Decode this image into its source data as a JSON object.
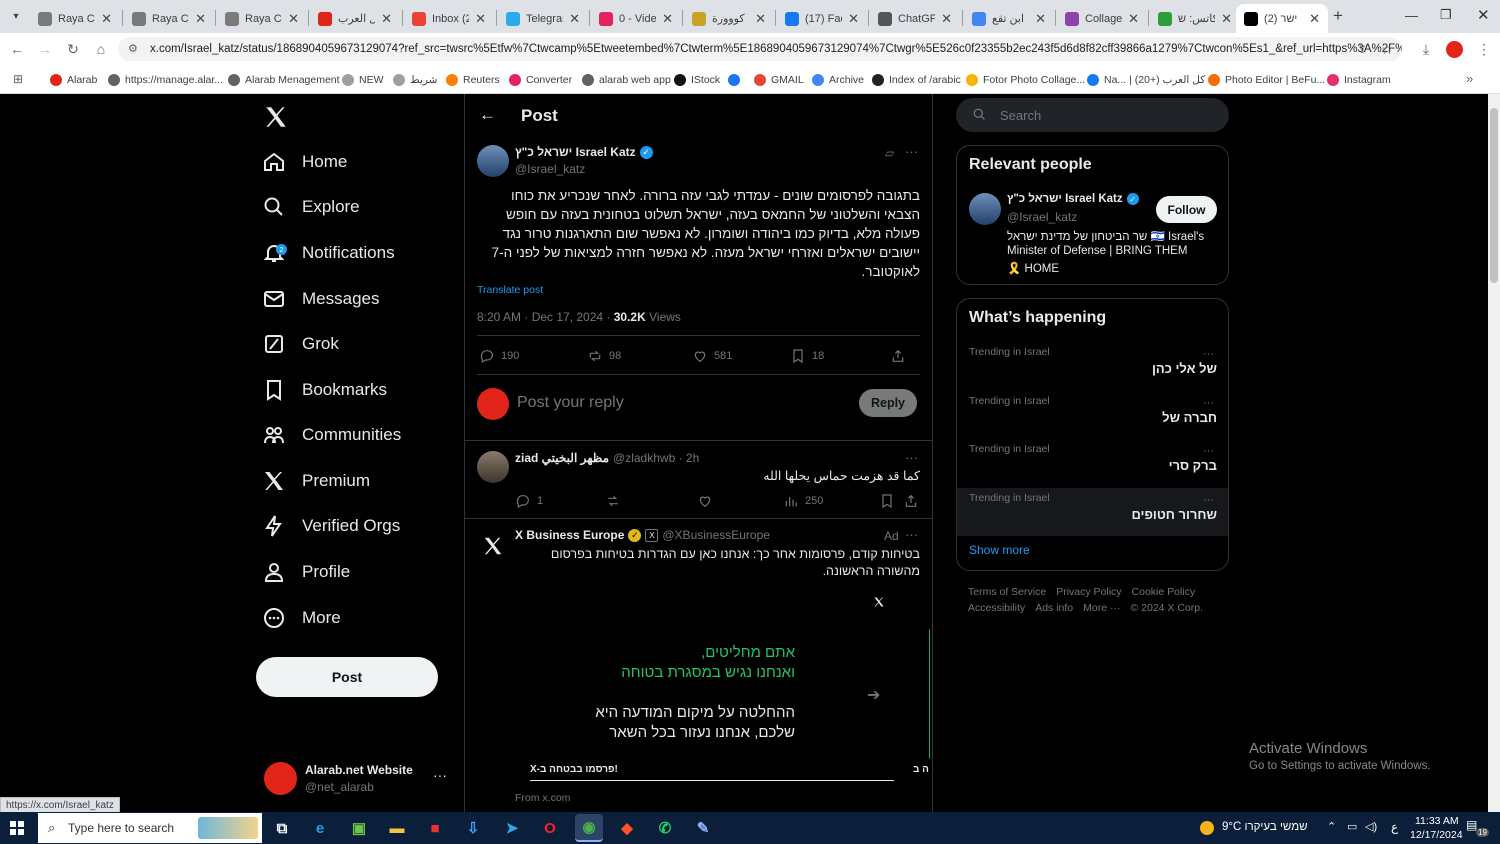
{
  "tabs": [
    {
      "label": "Raya CM",
      "color": "#7a7a7a"
    },
    {
      "label": "Raya CM",
      "color": "#7a7a7a"
    },
    {
      "label": "Raya CM",
      "color": "#7a7a7a"
    },
    {
      "label": "كل العرب",
      "color": "#e1251b"
    },
    {
      "label": "Inbox (2)",
      "color": "#ea4335"
    },
    {
      "label": "Telegram",
      "color": "#2aabee"
    },
    {
      "label": "0 - Video",
      "color": "#e0245e"
    },
    {
      "label": "كووورة",
      "color": "#c9a227"
    },
    {
      "label": "(17) Face",
      "color": "#1877f2"
    },
    {
      "label": "ChatGPT",
      "color": "#555555"
    },
    {
      "label": "ابن تقع",
      "color": "#4285f4"
    },
    {
      "label": "Collage",
      "color": "#8e44ad"
    },
    {
      "label": "كاتس: ש",
      "color": "#2e9d3e"
    },
    {
      "label": "(2) ישר",
      "color": "#000000"
    }
  ],
  "new_tab": "+",
  "url": "x.com/Israel_katz/status/1868904059673129074?ref_src=twsrc%5Etfw%7Ctwcamp%5Etweetembed%7Ctwterm%5E1868904059673129074%7Ctwgr%5E526c0f23355b2ec243f5d6d8f82cff39866a1279%7Ctwcon%5Es1_&ref_url=https%3A%2F%2Fara...",
  "bookmarks": [
    {
      "label": "Alarab",
      "color": "#e1251b"
    },
    {
      "label": "https://manage.alar...",
      "color": "#5f6368"
    },
    {
      "label": "Alarab Menagement",
      "color": "#5f6368"
    },
    {
      "label": "NEW",
      "color": "#9aa0a6"
    },
    {
      "label": "شريط",
      "color": "#9aa0a6"
    },
    {
      "label": "Reuters",
      "color": "#ff8000"
    },
    {
      "label": "Converter",
      "color": "#e0245e"
    },
    {
      "label": "alarab web app",
      "color": "#5f6368"
    },
    {
      "label": "IStock",
      "color": "#111111"
    },
    {
      "label": "",
      "color": "#1877f2"
    },
    {
      "label": "GMAIL",
      "color": "#ea4335"
    },
    {
      "label": "Archive",
      "color": "#4285f4"
    },
    {
      "label": "Index of /arabic",
      "color": "#222222"
    },
    {
      "label": "Fotor Photo Collage...",
      "color": "#f4b400"
    },
    {
      "label": "Na... | كل العرب (+20)",
      "color": "#1877f2"
    },
    {
      "label": "Photo Editor | BeFu...",
      "color": "#ff6b00"
    },
    {
      "label": "Instagram",
      "color": "#e1306c"
    }
  ],
  "nav": [
    {
      "label": "Home",
      "icon": "home-icon"
    },
    {
      "label": "Explore",
      "icon": "search-icon"
    },
    {
      "label": "Notifications",
      "icon": "bell-icon",
      "badge": "2"
    },
    {
      "label": "Messages",
      "icon": "mail-icon"
    },
    {
      "label": "Grok",
      "icon": "grok-icon"
    },
    {
      "label": "Bookmarks",
      "icon": "bookmark-icon"
    },
    {
      "label": "Communities",
      "icon": "communities-icon"
    },
    {
      "label": "Premium",
      "icon": "x-logo-icon"
    },
    {
      "label": "Verified Orgs",
      "icon": "lightning-icon"
    },
    {
      "label": "Profile",
      "icon": "person-icon"
    },
    {
      "label": "More",
      "icon": "more-circle-icon"
    }
  ],
  "post_button": "Post",
  "account": {
    "name": "Alarab.net Website",
    "handle": "@net_alarab"
  },
  "header": {
    "title": "Post"
  },
  "tweet": {
    "name": "ישראל כ\"ץ Israel Katz",
    "handle": "@Israel_katz",
    "text": "בתגובה לפרסומים שונים - עמדתי לגבי עזה ברורה. לאחר שנכריע את כוחו הצבאי והשלטוני של החמאס בעזה, ישראל תשלוט בטחונית בעזה עם חופש פעולה מלא, בדיוק כמו ביהודה ושומרון. לא נאפשר שום התארגנות טרור נגד יישובים ישראלים ואזרחי ישראל מעזה. לא נאפשר חזרה למציאות של לפני ה-7 לאוקטובר.",
    "translate": "Translate post",
    "time": "8:20 AM · Dec 17, 2024 · ",
    "views_count": "30.2K",
    "views_label": " Views",
    "replies": "190",
    "reposts": "98",
    "likes": "581",
    "bookmarks": "18"
  },
  "reply_box": {
    "placeholder": "Post your reply",
    "button": "Reply"
  },
  "reply": {
    "name": "ziad مظهر البخيتي",
    "handle": "@zladkhwb · 2h",
    "text": "كما قد هزمت حماس يحلها الله",
    "replies": "1",
    "views": "250"
  },
  "ad": {
    "name": "X Business Europe",
    "handle": "@XBusinessEurope",
    "label": "Ad",
    "text": "בטיחות קודם, פרסומות אחר כך: אנחנו כאן עם הגדרות בטיחות בפרסום מהשורה הראשונה.",
    "card_line1": "אתם מחליטים,",
    "card_line2": "ואנחנו נגיש במסגרת בטוחה",
    "card_line3": "ההחלטה על מיקום המודעה היא",
    "card_line4": "שלכם, אנחנו נעזור בכל השאר",
    "card_caption": "X-פרסמו בבטחה ב!",
    "card_caption2": "ה ב",
    "from": "From x.com"
  },
  "search": {
    "placeholder": "Search"
  },
  "relevant": {
    "title": "Relevant people",
    "name": "ישראל כ\"ץ Israel Katz",
    "handle": "@Israel_katz",
    "follow": "Follow",
    "bio1": "שר הביטחון של מדינת ישראל 🇮🇱 Israel's",
    "bio2": "Minister of Defense | BRING THEM",
    "bio3": "🎗️ HOME"
  },
  "happening": {
    "title": "What’s happening",
    "trends": [
      {
        "category": "Trending in Israel",
        "name": "של אלי כהן"
      },
      {
        "category": "Trending in Israel",
        "name": "חברה של"
      },
      {
        "category": "Trending in Israel",
        "name": "ברק סרי"
      },
      {
        "category": "Trending in Israel",
        "name": "שחרור חטופים"
      }
    ],
    "show_more": "Show more"
  },
  "footer": {
    "line1": [
      "Terms of Service",
      "Privacy Policy",
      "Cookie Policy"
    ],
    "line2": [
      "Accessibility",
      "Ads info",
      "More ···",
      "© 2024 X Corp."
    ]
  },
  "watermark": {
    "title": "Activate Windows",
    "subtitle": "Go to Settings to activate Windows."
  },
  "status_url": "https://x.com/Israel_katz",
  "taskbar": {
    "search": "Type here to search",
    "weather": "9°C שמשי בעיקרו",
    "time": "11:33 AM",
    "date": "12/17/2024",
    "lang": "ع",
    "notif_count": "19"
  }
}
